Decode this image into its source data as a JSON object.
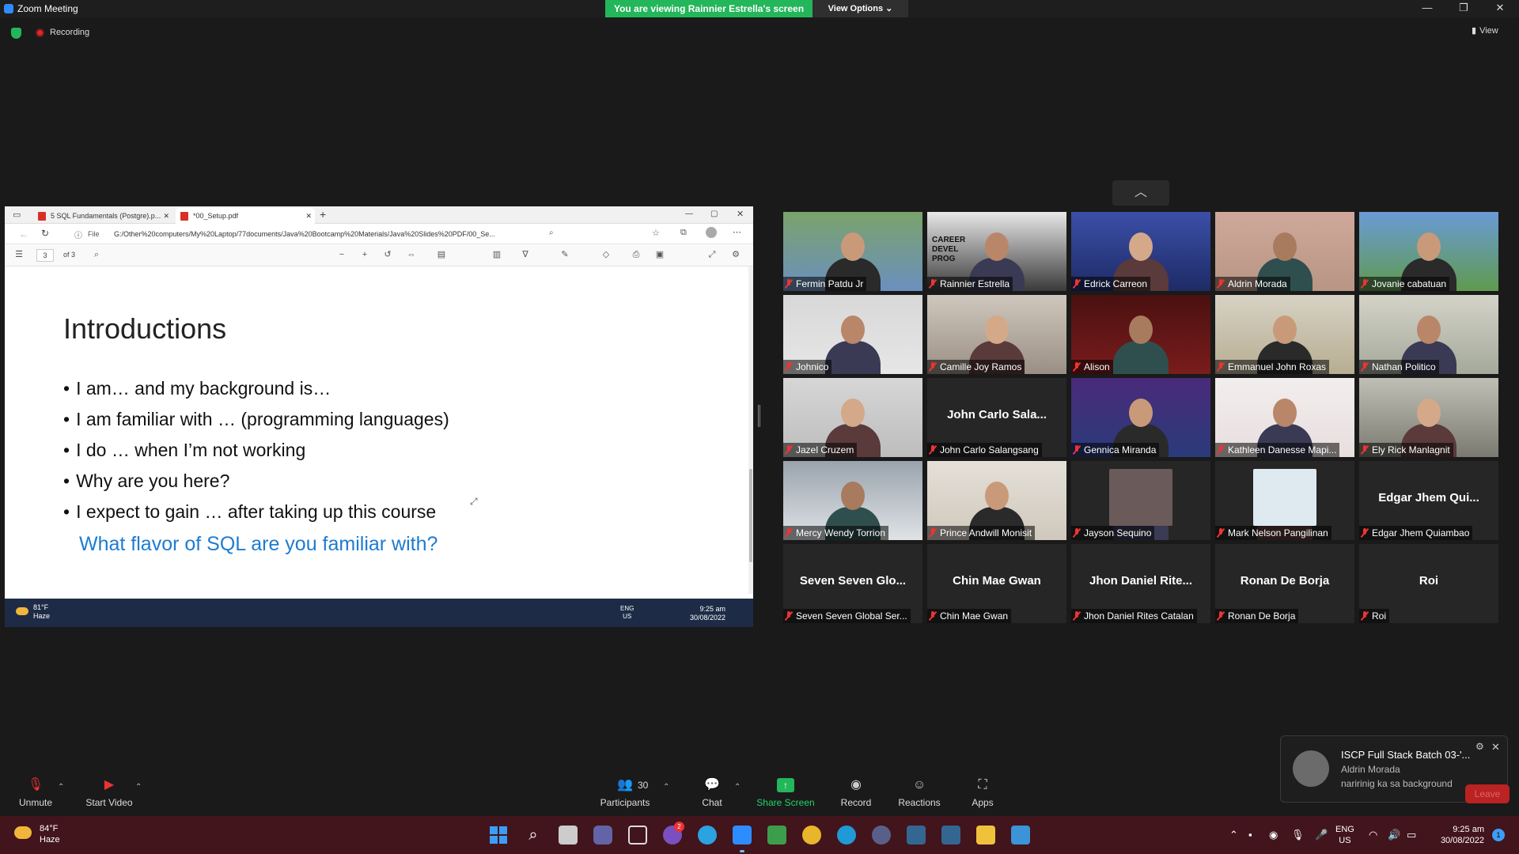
{
  "window": {
    "title": "Zoom Meeting",
    "viewing_banner": "You are viewing Rainnier Estrella's screen",
    "view_options": "View Options ⌄",
    "minimize": "—",
    "maximize": "❐",
    "close": "✕"
  },
  "status": {
    "recording": "Recording",
    "view": "View"
  },
  "shared_screen": {
    "tabs": [
      "5 SQL Fundamentals (Postgre).p...",
      "*00_Setup.pdf"
    ],
    "file_label": "File",
    "url": "G:/Other%20computers/My%20Laptop/77documents/Java%20Bootcamp%20Materials/Java%20Slides%20PDF/00_Se...",
    "page_current": "3",
    "page_total": "of 3",
    "slide_title": "Introductions",
    "bullets": [
      "I am… and my background is…",
      "I am familiar with … (programming languages)",
      "I do … when I’m not working",
      "Why are you here?",
      "I expect to gain … after taking up this course"
    ],
    "question": "What flavor of SQL are you familiar with?",
    "inner_weather_temp": "81°F",
    "inner_weather_desc": "Haze",
    "inner_lang": "ENG",
    "inner_region": "US",
    "inner_time": "9:25 am",
    "inner_date": "30/08/2022"
  },
  "participants": [
    {
      "name": "Fermin Patdu Jr",
      "video": true
    },
    {
      "name": "Rainnier Estrella",
      "video": true,
      "poster_text": "CAREER DEVEL PROG"
    },
    {
      "name": "Edrick Carreon",
      "video": true
    },
    {
      "name": "Aldrin Morada",
      "video": true
    },
    {
      "name": "Jovanie cabatuan",
      "video": true
    },
    {
      "name": "Johnico",
      "video": true
    },
    {
      "name": "Camille Joy Ramos",
      "video": true
    },
    {
      "name": "Alison",
      "video": true
    },
    {
      "name": "Emmanuel John Roxas",
      "video": true,
      "active": true
    },
    {
      "name": "Nathan Politico",
      "video": true
    },
    {
      "name": "Jazel Cruzem",
      "video": true
    },
    {
      "name": "John Carlo Salangsang",
      "video": false,
      "display": "John Carlo Sala..."
    },
    {
      "name": "Gennica Miranda",
      "video": true
    },
    {
      "name": "Kathleen Danesse Mapi...",
      "video": true
    },
    {
      "name": "Ely Rick Manlagnit",
      "video": true
    },
    {
      "name": "Mercy Wendy Torrion",
      "video": true
    },
    {
      "name": "Prince Andwill Monisit",
      "video": true
    },
    {
      "name": "Jayson Sequino",
      "video": true
    },
    {
      "name": "Mark Nelson Pangilinan",
      "video": true
    },
    {
      "name": "Edgar Jhem Quiambao",
      "video": false,
      "display": "Edgar Jhem Qui..."
    },
    {
      "name": "Seven Seven Global Ser...",
      "video": false,
      "display": "Seven Seven Glo..."
    },
    {
      "name": "Chin Mae Gwan",
      "video": false,
      "display": "Chin Mae Gwan"
    },
    {
      "name": "Jhon Daniel Rites Catalan",
      "video": false,
      "display": "Jhon Daniel Rite..."
    },
    {
      "name": "Ronan De Borja",
      "video": false,
      "display": "Ronan De Borja"
    },
    {
      "name": "Roi",
      "video": false,
      "display": "Roi"
    }
  ],
  "notification": {
    "title": "ISCP Full Stack Batch 03-'...",
    "sender": "Aldrin Morada",
    "message": "naririnig ka sa background",
    "leave": "Leave"
  },
  "toolbar": {
    "unmute": "Unmute",
    "start_video": "Start Video",
    "participants": "Participants",
    "participant_count": "30",
    "chat": "Chat",
    "share_screen": "Share Screen",
    "record": "Record",
    "reactions": "Reactions",
    "apps": "Apps"
  },
  "taskbar": {
    "weather_temp": "84°F",
    "weather_desc": "Haze",
    "lang": "ENG",
    "region": "US",
    "time": "9:25 am",
    "date": "30/08/2022",
    "notification_count": "1",
    "viber_badge": "2"
  },
  "colors": {
    "banner_green": "#23b65a",
    "active_speaker": "#c8e85a",
    "link_blue": "#1e7bd1",
    "taskbar": "#42141c"
  }
}
